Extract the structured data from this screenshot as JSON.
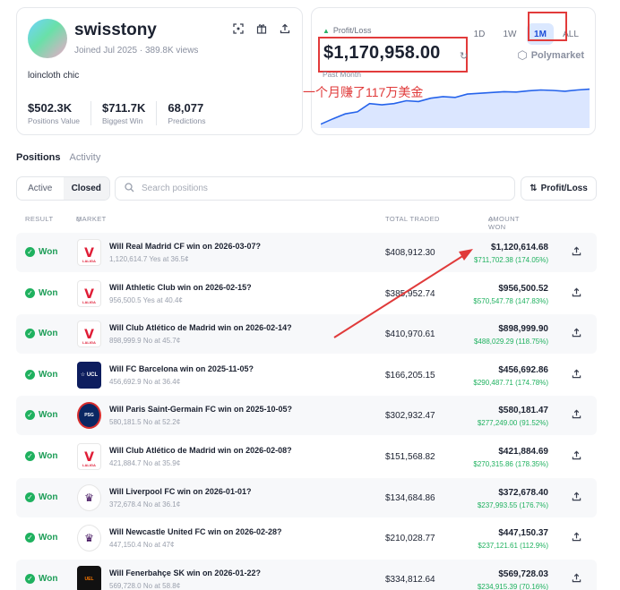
{
  "profile": {
    "username": "swisstony",
    "joined": "Joined Jul 2025",
    "views": "389.8K views",
    "bio": "loincloth chic",
    "stats": [
      {
        "value": "$502.3K",
        "label": "Positions Value"
      },
      {
        "value": "$711.7K",
        "label": "Biggest Win"
      },
      {
        "value": "68,077",
        "label": "Predictions"
      }
    ]
  },
  "pnl": {
    "label": "Profit/Loss",
    "value": "$1,170,958.00",
    "period": "Past Month",
    "brand": "Polymarket",
    "annotation": "一个月赚了117万美金",
    "tabs": [
      "1D",
      "1W",
      "1M",
      "ALL"
    ],
    "active_tab": "1M",
    "accent": "#1d4ed8",
    "highlight": "#e23b3b"
  },
  "nav": {
    "positions": "Positions",
    "activity": "Activity",
    "active": "Active",
    "closed": "Closed",
    "search_placeholder": "Search positions",
    "pl_button": "Profit/Loss"
  },
  "table": {
    "headers": {
      "result": "RESULT",
      "market": "MARKET",
      "traded": "TOTAL TRADED",
      "won": "AMOUNT WON"
    },
    "rows": [
      {
        "result": "Won",
        "logo": "laliga",
        "title": "Will Real Madrid CF win on 2026-03-07?",
        "sub": "1,120,614.7 Yes at 36.5¢",
        "traded": "$408,912.30",
        "amount": "$1,120,614.68",
        "pct": "$711,702.38 (174.05%)"
      },
      {
        "result": "Won",
        "logo": "laliga",
        "title": "Will Athletic Club win on 2026-02-15?",
        "sub": "956,500.5 Yes at 40.4¢",
        "traded": "$385,952.74",
        "amount": "$956,500.52",
        "pct": "$570,547.78 (147.83%)"
      },
      {
        "result": "Won",
        "logo": "laliga",
        "title": "Will Club Atlético de Madrid win on 2026-02-14?",
        "sub": "898,999.9 No at 45.7¢",
        "traded": "$410,970.61",
        "amount": "$898,999.90",
        "pct": "$488,029.29 (118.75%)"
      },
      {
        "result": "Won",
        "logo": "ucl",
        "title": "Will FC Barcelona win on 2025-11-05?",
        "sub": "456,692.9 No at 36.4¢",
        "traded": "$166,205.15",
        "amount": "$456,692.86",
        "pct": "$290,487.71 (174.78%)"
      },
      {
        "result": "Won",
        "logo": "psg",
        "title": "Will Paris Saint-Germain FC win on 2025-10-05?",
        "sub": "580,181.5 No at 52.2¢",
        "traded": "$302,932.47",
        "amount": "$580,181.47",
        "pct": "$277,249.00 (91.52%)"
      },
      {
        "result": "Won",
        "logo": "laliga",
        "title": "Will Club Atlético de Madrid win on 2026-02-08?",
        "sub": "421,884.7 No at 35.9¢",
        "traded": "$151,568.82",
        "amount": "$421,884.69",
        "pct": "$270,315.86 (178.35%)"
      },
      {
        "result": "Won",
        "logo": "epl",
        "title": "Will Liverpool FC win on 2026-01-01?",
        "sub": "372,678.4 No at 36.1¢",
        "traded": "$134,684.86",
        "amount": "$372,678.40",
        "pct": "$237,993.55 (176.7%)"
      },
      {
        "result": "Won",
        "logo": "epl",
        "title": "Will Newcastle United FC win on 2026-02-28?",
        "sub": "447,150.4 No at 47¢",
        "traded": "$210,028.77",
        "amount": "$447,150.37",
        "pct": "$237,121.61 (112.9%)"
      },
      {
        "result": "Won",
        "logo": "uel",
        "title": "Will Fenerbahçe SK win on 2026-01-22?",
        "sub": "569,728.0 No at 58.8¢",
        "traded": "$334,812.64",
        "amount": "$569,728.03",
        "pct": "$234,915.39 (70.16%)"
      }
    ]
  },
  "logos": {
    "laliga": {
      "glyph": "Ⅴ",
      "sub": "LALIGA"
    },
    "ucl": {
      "glyph": "☆ UCL"
    },
    "psg": {
      "glyph": "PSG"
    },
    "epl": {
      "glyph": "♛"
    },
    "uel": {
      "glyph": "UEL"
    }
  },
  "chart_data": {
    "type": "line",
    "series": [
      {
        "values": [
          0.05,
          0.18,
          0.3,
          0.35,
          0.55,
          0.52,
          0.55,
          0.62,
          0.6,
          0.68,
          0.72,
          0.7,
          0.78,
          0.8,
          0.82,
          0.84,
          0.83,
          0.86,
          0.88,
          0.87,
          0.85,
          0.88,
          0.9
        ]
      }
    ],
    "color": "#2563eb",
    "fill": "#dbe6ff"
  }
}
